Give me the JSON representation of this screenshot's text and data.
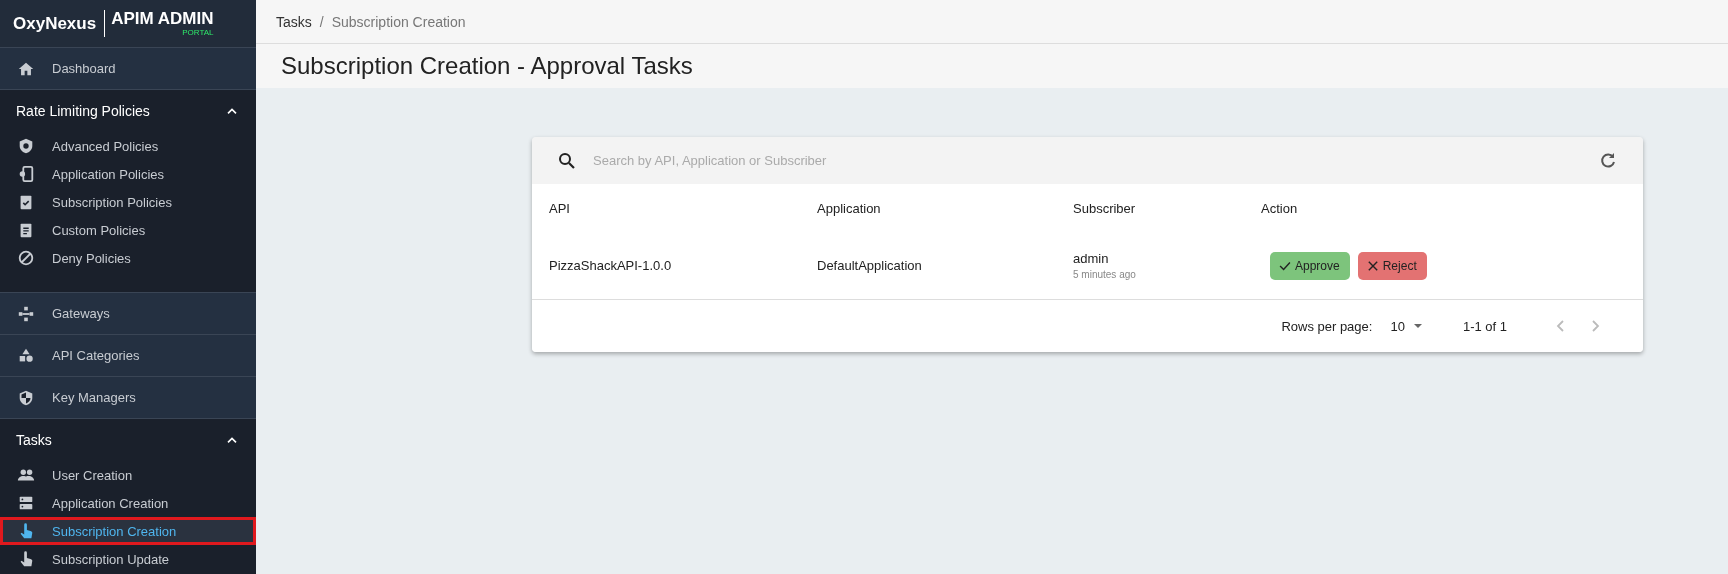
{
  "logo": {
    "brand": "OxyNexus",
    "product": "APIM ADMIN",
    "tagline": "PORTAL"
  },
  "sidebar": {
    "groups": [
      {
        "kind": "link",
        "label": "Dashboard",
        "selected": false
      },
      {
        "kind": "section",
        "label": "Rate Limiting Policies",
        "expanded": true,
        "items": [
          {
            "label": "Advanced Policies",
            "selected": false
          },
          {
            "label": "Application Policies",
            "selected": false
          },
          {
            "label": "Subscription Policies",
            "selected": false
          },
          {
            "label": "Custom Policies",
            "selected": false
          },
          {
            "label": "Deny Policies",
            "selected": false
          }
        ]
      },
      {
        "kind": "link",
        "label": "Gateways",
        "selected": false
      },
      {
        "kind": "link",
        "label": "API Categories",
        "selected": false
      },
      {
        "kind": "link",
        "label": "Key Managers",
        "selected": false
      },
      {
        "kind": "section",
        "label": "Tasks",
        "expanded": true,
        "items": [
          {
            "label": "User Creation",
            "selected": false
          },
          {
            "label": "Application Creation",
            "selected": false
          },
          {
            "label": "Subscription Creation",
            "selected": true
          },
          {
            "label": "Subscription Update",
            "selected": false
          }
        ]
      }
    ]
  },
  "breadcrumb": {
    "items": [
      "Tasks",
      "Subscription Creation"
    ],
    "separator": "/"
  },
  "page_title": "Subscription Creation - Approval Tasks",
  "search": {
    "placeholder": "Search by API, Application or Subscriber"
  },
  "table": {
    "columns": [
      "API",
      "Application",
      "Subscriber",
      "Action"
    ],
    "rows": [
      {
        "api": "PizzaShackAPI-1.0.0",
        "application": "DefaultApplication",
        "subscriber": "admin",
        "time": "5 minutes ago",
        "approve": "Approve",
        "reject": "Reject"
      }
    ]
  },
  "pagination": {
    "rows_label": "Rows per page:",
    "rows_value": "10",
    "range": "1-1 of 1"
  }
}
